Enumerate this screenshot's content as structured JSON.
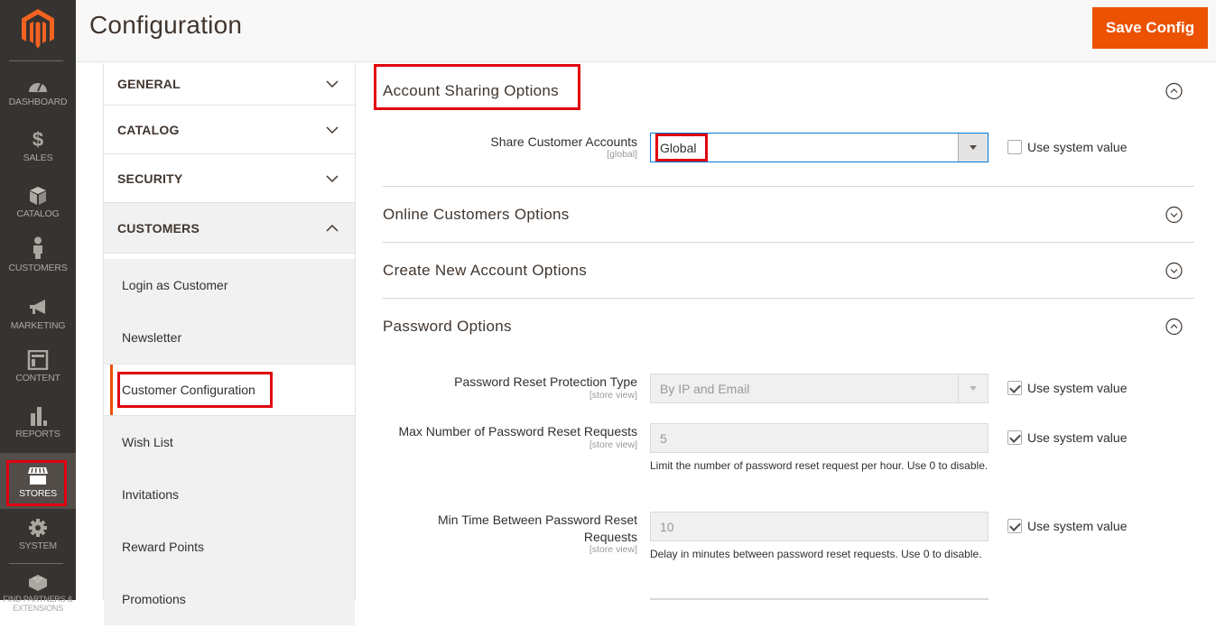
{
  "admin_menu": {
    "logo": "magento-logo",
    "items": [
      {
        "id": "dashboard",
        "label": "DASHBOARD",
        "icon": "dashboard-gauge-icon"
      },
      {
        "id": "sales",
        "label": "SALES",
        "icon": "dollar-icon"
      },
      {
        "id": "catalog",
        "label": "CATALOG",
        "icon": "box-icon"
      },
      {
        "id": "customers",
        "label": "CUSTOMERS",
        "icon": "person-icon"
      },
      {
        "id": "marketing",
        "label": "MARKETING",
        "icon": "megaphone-icon"
      },
      {
        "id": "content",
        "label": "CONTENT",
        "icon": "layout-icon"
      },
      {
        "id": "reports",
        "label": "REPORTS",
        "icon": "bar-chart-icon"
      },
      {
        "id": "stores",
        "label": "STORES",
        "icon": "storefront-icon",
        "active": true
      },
      {
        "id": "system",
        "label": "SYSTEM",
        "icon": "gear-icon"
      },
      {
        "id": "find-partners",
        "label": "FIND PARTNERS & EXTENSIONS",
        "icon": "lego-brick-icon"
      }
    ]
  },
  "header": {
    "title": "Configuration",
    "save_label": "Save Config"
  },
  "config_tabs": {
    "groups": [
      {
        "label": "GENERAL",
        "open": false
      },
      {
        "label": "CATALOG",
        "open": false
      },
      {
        "label": "SECURITY",
        "open": false
      },
      {
        "label": "CUSTOMERS",
        "open": true
      }
    ],
    "customers_items": [
      {
        "label": "Login as Customer"
      },
      {
        "label": "Newsletter"
      },
      {
        "label": "Customer Configuration",
        "active": true
      },
      {
        "label": "Wish List"
      },
      {
        "label": "Invitations"
      },
      {
        "label": "Reward Points"
      },
      {
        "label": "Promotions"
      }
    ]
  },
  "main": {
    "sections": [
      {
        "title": "Account Sharing Options",
        "expanded": true
      },
      {
        "title": "Online Customers Options",
        "expanded": false
      },
      {
        "title": "Create New Account Options",
        "expanded": false
      },
      {
        "title": "Password Options",
        "expanded": true
      }
    ],
    "account_sharing": {
      "share_accounts": {
        "label": "Share Customer Accounts",
        "scope": "[global]",
        "value": "Global",
        "use_system_value": false,
        "use_system_label": "Use system value"
      }
    },
    "password_options": {
      "reset_protection": {
        "label": "Password Reset Protection Type",
        "scope": "[store view]",
        "value": "By IP and Email",
        "use_system_value": true,
        "use_system_label": "Use system value"
      },
      "max_requests": {
        "label": "Max Number of Password Reset Requests",
        "scope": "[store view]",
        "value": "5",
        "hint": "Limit the number of password reset request per hour. Use 0 to disable.",
        "use_system_value": true,
        "use_system_label": "Use system value"
      },
      "min_time": {
        "label_line1": "Min Time Between Password Reset",
        "label_line2": "Requests",
        "scope": "[store view]",
        "value": "10",
        "hint": "Delay in minutes between password reset requests. Use 0 to disable.",
        "use_system_value": true,
        "use_system_label": "Use system value"
      }
    }
  },
  "colors": {
    "accent": "#eb5202",
    "menu_bg": "#373330",
    "highlight": "#e0000f",
    "focus": "#007bdb"
  }
}
